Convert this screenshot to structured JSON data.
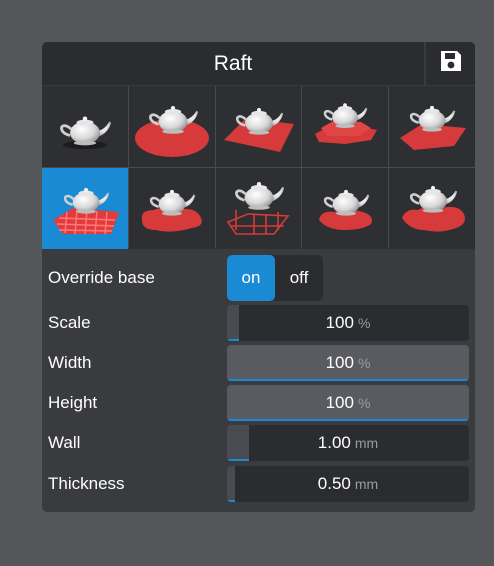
{
  "header": {
    "title": "Raft",
    "save_icon": "save-icon"
  },
  "presets": [
    {
      "name": "none"
    },
    {
      "name": "disc"
    },
    {
      "name": "square"
    },
    {
      "name": "stacked-plates"
    },
    {
      "name": "slanted-square"
    },
    {
      "name": "lattice",
      "selected": true
    },
    {
      "name": "blob"
    },
    {
      "name": "cage"
    },
    {
      "name": "small-blob"
    },
    {
      "name": "wavy-blob"
    }
  ],
  "override_base": {
    "label": "Override base",
    "on_label": "on",
    "off_label": "off",
    "value": "on"
  },
  "settings": [
    {
      "label": "Scale",
      "value": "100",
      "unit": "%",
      "fill_fraction": 0.05
    },
    {
      "label": "Width",
      "value": "100",
      "unit": "%",
      "fill_fraction": 1.0
    },
    {
      "label": "Height",
      "value": "100",
      "unit": "%",
      "fill_fraction": 1.0
    },
    {
      "label": "Wall",
      "value": "1.00",
      "unit": "mm",
      "fill_fraction": 0.09
    },
    {
      "label": "Thickness",
      "value": "0.50",
      "unit": "mm",
      "fill_fraction": 0.03
    }
  ],
  "colors": {
    "accent": "#1a8ad4",
    "raft": "#d63a3a",
    "panel": "#3a3b3e"
  }
}
